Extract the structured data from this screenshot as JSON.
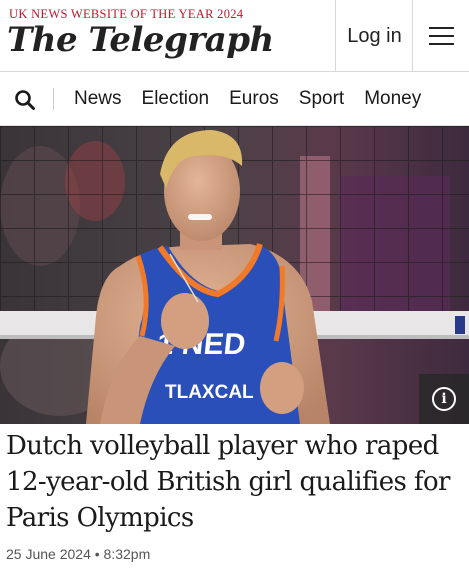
{
  "masthead": {
    "kicker": "UK News Website of the Year 2024",
    "logo_text": "The Telegraph",
    "login_label": "Log in",
    "menu_icon": "hamburger-menu-icon"
  },
  "nav": {
    "search_icon": "search-icon",
    "items": [
      "News",
      "Election",
      "Euros",
      "Sport",
      "Money"
    ]
  },
  "article": {
    "image_jersey_text_1": "1 NED",
    "image_jersey_text_2": "TLAXCAL",
    "info_icon": "info-icon",
    "headline": "Dutch volleyball player who raped 12-year-old British girl qualifies for Paris Olympics",
    "date": "25 June 2024",
    "time": "8:32pm",
    "separator": "•"
  },
  "colors": {
    "kicker_red": "#c0172c",
    "jersey_blue": "#2a4fb8",
    "jersey_orange": "#f07a2a"
  }
}
